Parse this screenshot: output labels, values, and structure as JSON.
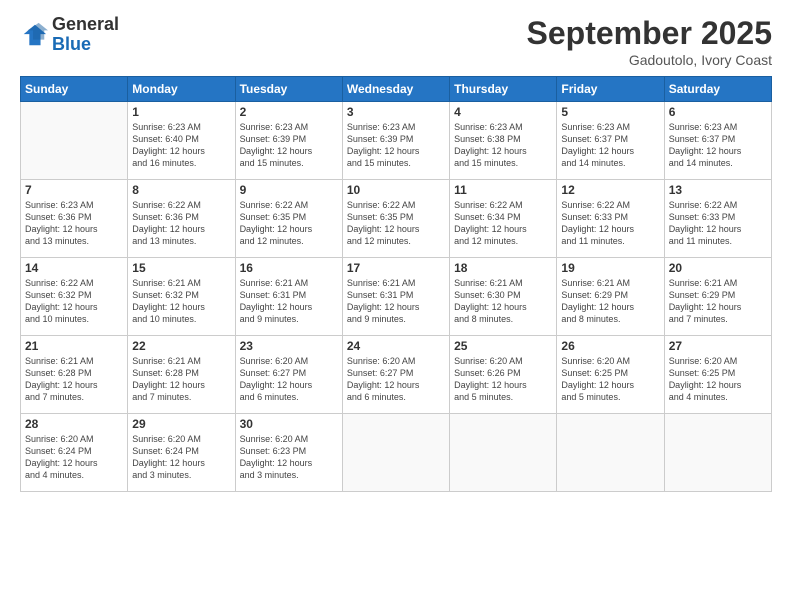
{
  "header": {
    "logo_line1": "General",
    "logo_line2": "Blue",
    "month": "September 2025",
    "location": "Gadoutolo, Ivory Coast"
  },
  "weekdays": [
    "Sunday",
    "Monday",
    "Tuesday",
    "Wednesday",
    "Thursday",
    "Friday",
    "Saturday"
  ],
  "weeks": [
    [
      {
        "day": "",
        "info": ""
      },
      {
        "day": "1",
        "info": "Sunrise: 6:23 AM\nSunset: 6:40 PM\nDaylight: 12 hours\nand 16 minutes."
      },
      {
        "day": "2",
        "info": "Sunrise: 6:23 AM\nSunset: 6:39 PM\nDaylight: 12 hours\nand 15 minutes."
      },
      {
        "day": "3",
        "info": "Sunrise: 6:23 AM\nSunset: 6:39 PM\nDaylight: 12 hours\nand 15 minutes."
      },
      {
        "day": "4",
        "info": "Sunrise: 6:23 AM\nSunset: 6:38 PM\nDaylight: 12 hours\nand 15 minutes."
      },
      {
        "day": "5",
        "info": "Sunrise: 6:23 AM\nSunset: 6:37 PM\nDaylight: 12 hours\nand 14 minutes."
      },
      {
        "day": "6",
        "info": "Sunrise: 6:23 AM\nSunset: 6:37 PM\nDaylight: 12 hours\nand 14 minutes."
      }
    ],
    [
      {
        "day": "7",
        "info": "Sunrise: 6:23 AM\nSunset: 6:36 PM\nDaylight: 12 hours\nand 13 minutes."
      },
      {
        "day": "8",
        "info": "Sunrise: 6:22 AM\nSunset: 6:36 PM\nDaylight: 12 hours\nand 13 minutes."
      },
      {
        "day": "9",
        "info": "Sunrise: 6:22 AM\nSunset: 6:35 PM\nDaylight: 12 hours\nand 12 minutes."
      },
      {
        "day": "10",
        "info": "Sunrise: 6:22 AM\nSunset: 6:35 PM\nDaylight: 12 hours\nand 12 minutes."
      },
      {
        "day": "11",
        "info": "Sunrise: 6:22 AM\nSunset: 6:34 PM\nDaylight: 12 hours\nand 12 minutes."
      },
      {
        "day": "12",
        "info": "Sunrise: 6:22 AM\nSunset: 6:33 PM\nDaylight: 12 hours\nand 11 minutes."
      },
      {
        "day": "13",
        "info": "Sunrise: 6:22 AM\nSunset: 6:33 PM\nDaylight: 12 hours\nand 11 minutes."
      }
    ],
    [
      {
        "day": "14",
        "info": "Sunrise: 6:22 AM\nSunset: 6:32 PM\nDaylight: 12 hours\nand 10 minutes."
      },
      {
        "day": "15",
        "info": "Sunrise: 6:21 AM\nSunset: 6:32 PM\nDaylight: 12 hours\nand 10 minutes."
      },
      {
        "day": "16",
        "info": "Sunrise: 6:21 AM\nSunset: 6:31 PM\nDaylight: 12 hours\nand 9 minutes."
      },
      {
        "day": "17",
        "info": "Sunrise: 6:21 AM\nSunset: 6:31 PM\nDaylight: 12 hours\nand 9 minutes."
      },
      {
        "day": "18",
        "info": "Sunrise: 6:21 AM\nSunset: 6:30 PM\nDaylight: 12 hours\nand 8 minutes."
      },
      {
        "day": "19",
        "info": "Sunrise: 6:21 AM\nSunset: 6:29 PM\nDaylight: 12 hours\nand 8 minutes."
      },
      {
        "day": "20",
        "info": "Sunrise: 6:21 AM\nSunset: 6:29 PM\nDaylight: 12 hours\nand 7 minutes."
      }
    ],
    [
      {
        "day": "21",
        "info": "Sunrise: 6:21 AM\nSunset: 6:28 PM\nDaylight: 12 hours\nand 7 minutes."
      },
      {
        "day": "22",
        "info": "Sunrise: 6:21 AM\nSunset: 6:28 PM\nDaylight: 12 hours\nand 7 minutes."
      },
      {
        "day": "23",
        "info": "Sunrise: 6:20 AM\nSunset: 6:27 PM\nDaylight: 12 hours\nand 6 minutes."
      },
      {
        "day": "24",
        "info": "Sunrise: 6:20 AM\nSunset: 6:27 PM\nDaylight: 12 hours\nand 6 minutes."
      },
      {
        "day": "25",
        "info": "Sunrise: 6:20 AM\nSunset: 6:26 PM\nDaylight: 12 hours\nand 5 minutes."
      },
      {
        "day": "26",
        "info": "Sunrise: 6:20 AM\nSunset: 6:25 PM\nDaylight: 12 hours\nand 5 minutes."
      },
      {
        "day": "27",
        "info": "Sunrise: 6:20 AM\nSunset: 6:25 PM\nDaylight: 12 hours\nand 4 minutes."
      }
    ],
    [
      {
        "day": "28",
        "info": "Sunrise: 6:20 AM\nSunset: 6:24 PM\nDaylight: 12 hours\nand 4 minutes."
      },
      {
        "day": "29",
        "info": "Sunrise: 6:20 AM\nSunset: 6:24 PM\nDaylight: 12 hours\nand 3 minutes."
      },
      {
        "day": "30",
        "info": "Sunrise: 6:20 AM\nSunset: 6:23 PM\nDaylight: 12 hours\nand 3 minutes."
      },
      {
        "day": "",
        "info": ""
      },
      {
        "day": "",
        "info": ""
      },
      {
        "day": "",
        "info": ""
      },
      {
        "day": "",
        "info": ""
      }
    ]
  ]
}
